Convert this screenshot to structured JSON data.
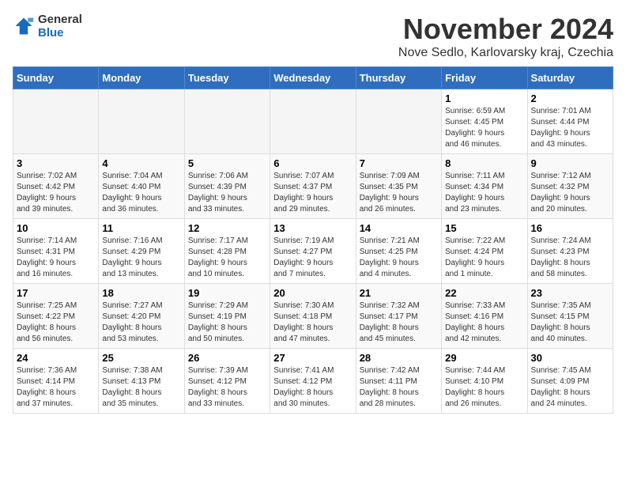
{
  "logo": {
    "line1": "General",
    "line2": "Blue"
  },
  "title": "November 2024",
  "location": "Nove Sedlo, Karlovarsky kraj, Czechia",
  "weekdays": [
    "Sunday",
    "Monday",
    "Tuesday",
    "Wednesday",
    "Thursday",
    "Friday",
    "Saturday"
  ],
  "weeks": [
    [
      {
        "day": "",
        "info": ""
      },
      {
        "day": "",
        "info": ""
      },
      {
        "day": "",
        "info": ""
      },
      {
        "day": "",
        "info": ""
      },
      {
        "day": "",
        "info": ""
      },
      {
        "day": "1",
        "info": "Sunrise: 6:59 AM\nSunset: 4:45 PM\nDaylight: 9 hours\nand 46 minutes."
      },
      {
        "day": "2",
        "info": "Sunrise: 7:01 AM\nSunset: 4:44 PM\nDaylight: 9 hours\nand 43 minutes."
      }
    ],
    [
      {
        "day": "3",
        "info": "Sunrise: 7:02 AM\nSunset: 4:42 PM\nDaylight: 9 hours\nand 39 minutes."
      },
      {
        "day": "4",
        "info": "Sunrise: 7:04 AM\nSunset: 4:40 PM\nDaylight: 9 hours\nand 36 minutes."
      },
      {
        "day": "5",
        "info": "Sunrise: 7:06 AM\nSunset: 4:39 PM\nDaylight: 9 hours\nand 33 minutes."
      },
      {
        "day": "6",
        "info": "Sunrise: 7:07 AM\nSunset: 4:37 PM\nDaylight: 9 hours\nand 29 minutes."
      },
      {
        "day": "7",
        "info": "Sunrise: 7:09 AM\nSunset: 4:35 PM\nDaylight: 9 hours\nand 26 minutes."
      },
      {
        "day": "8",
        "info": "Sunrise: 7:11 AM\nSunset: 4:34 PM\nDaylight: 9 hours\nand 23 minutes."
      },
      {
        "day": "9",
        "info": "Sunrise: 7:12 AM\nSunset: 4:32 PM\nDaylight: 9 hours\nand 20 minutes."
      }
    ],
    [
      {
        "day": "10",
        "info": "Sunrise: 7:14 AM\nSunset: 4:31 PM\nDaylight: 9 hours\nand 16 minutes."
      },
      {
        "day": "11",
        "info": "Sunrise: 7:16 AM\nSunset: 4:29 PM\nDaylight: 9 hours\nand 13 minutes."
      },
      {
        "day": "12",
        "info": "Sunrise: 7:17 AM\nSunset: 4:28 PM\nDaylight: 9 hours\nand 10 minutes."
      },
      {
        "day": "13",
        "info": "Sunrise: 7:19 AM\nSunset: 4:27 PM\nDaylight: 9 hours\nand 7 minutes."
      },
      {
        "day": "14",
        "info": "Sunrise: 7:21 AM\nSunset: 4:25 PM\nDaylight: 9 hours\nand 4 minutes."
      },
      {
        "day": "15",
        "info": "Sunrise: 7:22 AM\nSunset: 4:24 PM\nDaylight: 9 hours\nand 1 minute."
      },
      {
        "day": "16",
        "info": "Sunrise: 7:24 AM\nSunset: 4:23 PM\nDaylight: 8 hours\nand 58 minutes."
      }
    ],
    [
      {
        "day": "17",
        "info": "Sunrise: 7:25 AM\nSunset: 4:22 PM\nDaylight: 8 hours\nand 56 minutes."
      },
      {
        "day": "18",
        "info": "Sunrise: 7:27 AM\nSunset: 4:20 PM\nDaylight: 8 hours\nand 53 minutes."
      },
      {
        "day": "19",
        "info": "Sunrise: 7:29 AM\nSunset: 4:19 PM\nDaylight: 8 hours\nand 50 minutes."
      },
      {
        "day": "20",
        "info": "Sunrise: 7:30 AM\nSunset: 4:18 PM\nDaylight: 8 hours\nand 47 minutes."
      },
      {
        "day": "21",
        "info": "Sunrise: 7:32 AM\nSunset: 4:17 PM\nDaylight: 8 hours\nand 45 minutes."
      },
      {
        "day": "22",
        "info": "Sunrise: 7:33 AM\nSunset: 4:16 PM\nDaylight: 8 hours\nand 42 minutes."
      },
      {
        "day": "23",
        "info": "Sunrise: 7:35 AM\nSunset: 4:15 PM\nDaylight: 8 hours\nand 40 minutes."
      }
    ],
    [
      {
        "day": "24",
        "info": "Sunrise: 7:36 AM\nSunset: 4:14 PM\nDaylight: 8 hours\nand 37 minutes."
      },
      {
        "day": "25",
        "info": "Sunrise: 7:38 AM\nSunset: 4:13 PM\nDaylight: 8 hours\nand 35 minutes."
      },
      {
        "day": "26",
        "info": "Sunrise: 7:39 AM\nSunset: 4:12 PM\nDaylight: 8 hours\nand 33 minutes."
      },
      {
        "day": "27",
        "info": "Sunrise: 7:41 AM\nSunset: 4:12 PM\nDaylight: 8 hours\nand 30 minutes."
      },
      {
        "day": "28",
        "info": "Sunrise: 7:42 AM\nSunset: 4:11 PM\nDaylight: 8 hours\nand 28 minutes."
      },
      {
        "day": "29",
        "info": "Sunrise: 7:44 AM\nSunset: 4:10 PM\nDaylight: 8 hours\nand 26 minutes."
      },
      {
        "day": "30",
        "info": "Sunrise: 7:45 AM\nSunset: 4:09 PM\nDaylight: 8 hours\nand 24 minutes."
      }
    ]
  ]
}
